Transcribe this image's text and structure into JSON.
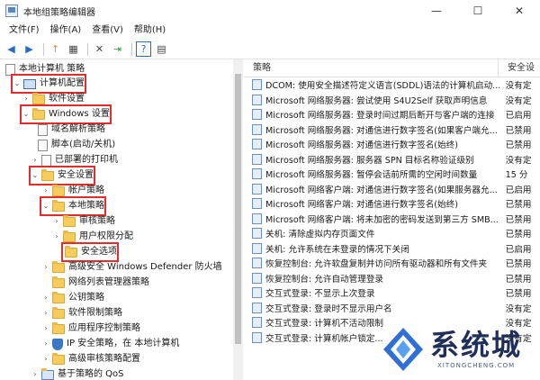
{
  "window": {
    "title": "本地组策略编辑器",
    "minimize": "—",
    "maximize": "☐",
    "close": "✕"
  },
  "menu": [
    "文件(F)",
    "操作(A)",
    "查看(V)",
    "帮助(H)"
  ],
  "toolbar": {
    "back": "◀",
    "forward": "▶",
    "up": "↑",
    "show_tree": "▦",
    "delete": "✕",
    "export": "⇥",
    "help": "?",
    "view": "▤"
  },
  "tree": {
    "root": "本地计算机 策略",
    "items": [
      "计算机配置",
      "软件设置",
      "Windows 设置",
      "域名解析策略",
      "脚本(启动/关机)",
      "已部署的打印机",
      "安全设置",
      "帐户策略",
      "本地策略",
      "审核策略",
      "用户权限分配",
      "安全选项",
      "高级安全 Windows Defender 防火墙",
      "网络列表管理器策略",
      "公钥策略",
      "软件限制策略",
      "应用程序控制策略",
      "IP 安全策略，在 本地计算机",
      "高级审核策略配置",
      "基于策略的 QoS"
    ],
    "twisty_open": "⌄",
    "twisty_closed": "›"
  },
  "columns": {
    "policy": "策略",
    "setting": "安全设"
  },
  "policies": [
    {
      "name": "DCOM: 使用安全描述符定义语言(SDDL)语法的计算机启动...",
      "setting": "没有定"
    },
    {
      "name": "Microsoft 网络服务器: 尝试使用 S4U2Self 获取声明信息",
      "setting": "没有定"
    },
    {
      "name": "Microsoft 网络服务器: 登录时间过期后断开与客户端的连接",
      "setting": "已启用"
    },
    {
      "name": "Microsoft 网络服务器: 对通信进行数字签名(如果客户端允...",
      "setting": "已禁用"
    },
    {
      "name": "Microsoft 网络服务器: 对通信进行数字签名(始终)",
      "setting": "已禁用"
    },
    {
      "name": "Microsoft 网络服务器: 服务器 SPN 目标名称验证级别",
      "setting": "没有定"
    },
    {
      "name": "Microsoft 网络服务器: 暂停会话前所需的空闲时间数量",
      "setting": "15 分"
    },
    {
      "name": "Microsoft 网络客户端: 对通信进行数字签名(如果服务器允...",
      "setting": "已启用"
    },
    {
      "name": "Microsoft 网络客户端: 对通信进行数字签名(始终)",
      "setting": "已禁用"
    },
    {
      "name": "Microsoft 网络客户端: 将未加密的密码发送到第三方 SMB...",
      "setting": "已禁用"
    },
    {
      "name": "关机: 清除虚拟内存页面文件",
      "setting": "已禁用"
    },
    {
      "name": "关机: 允许系统在未登录的情况下关闭",
      "setting": "已启用"
    },
    {
      "name": "恢复控制台: 允许软盘复制并访问所有驱动器和所有文件夹",
      "setting": "已禁用"
    },
    {
      "name": "恢复控制台: 允许自动管理登录",
      "setting": "已禁用"
    },
    {
      "name": "交互式登录: 不显示上次登录",
      "setting": "已禁用"
    },
    {
      "name": "交互式登录: 登录时不显示用户名",
      "setting": "没有定"
    },
    {
      "name": "交互式登录: 计算机不活动限制",
      "setting": "没有定"
    },
    {
      "name": "交互式登录: 计算机帐户锁定...",
      "setting": "没有定"
    }
  ],
  "watermark": {
    "text": "系统城",
    "sub": "XITONGCHENG.COM"
  },
  "colors": {
    "highlight": "#e32c2c",
    "folder": "#f6cd5d"
  }
}
